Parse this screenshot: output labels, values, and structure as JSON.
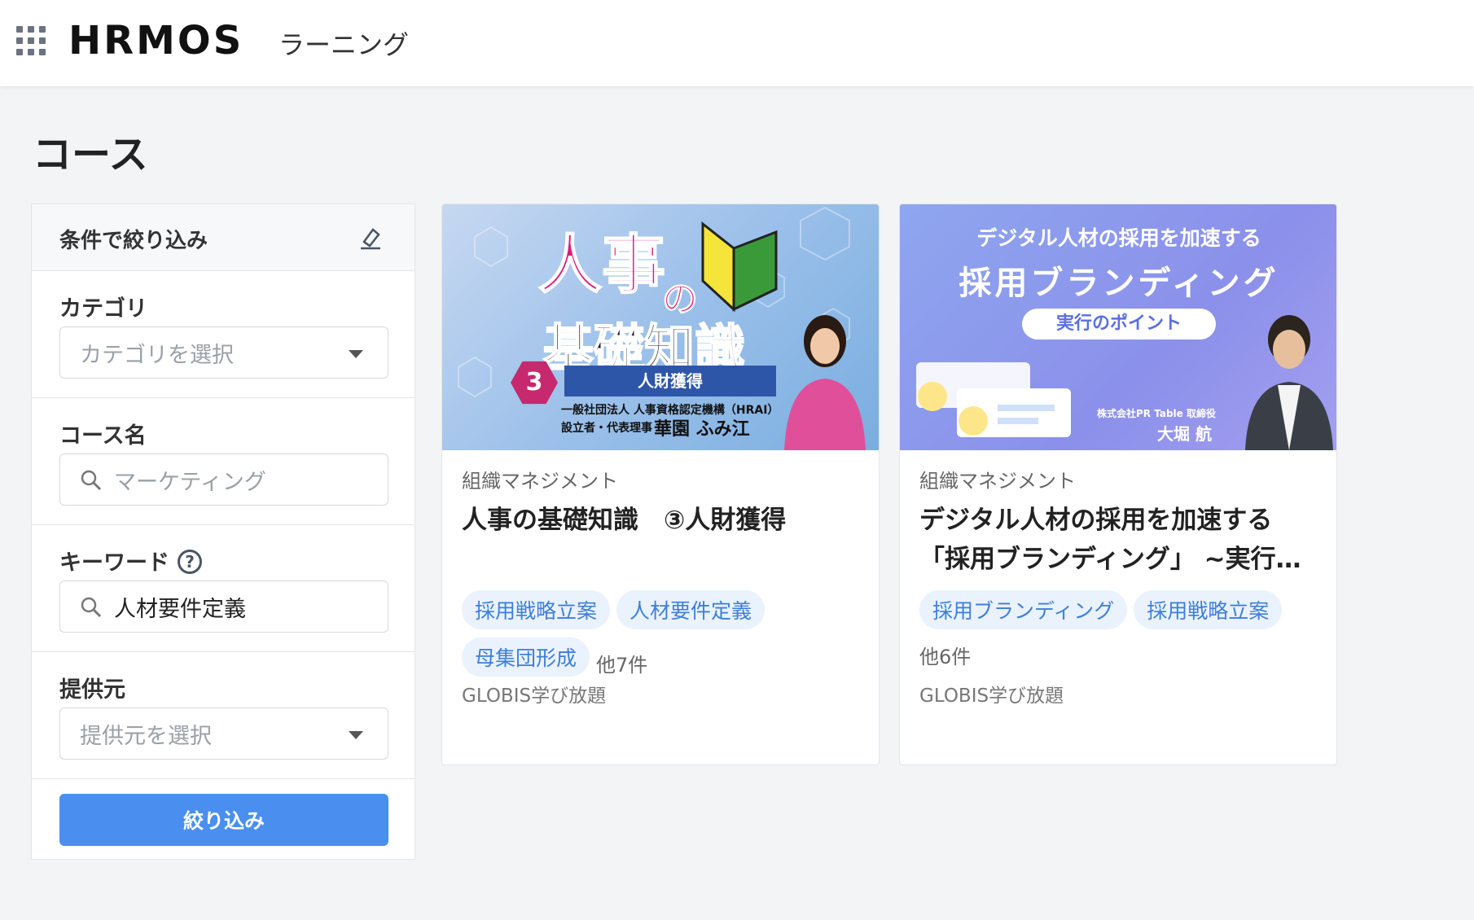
{
  "header": {
    "logo": "HRMOS",
    "product": "ラーニング"
  },
  "page": {
    "title": "コース"
  },
  "filter": {
    "title": "条件で絞り込み",
    "category": {
      "label": "カテゴリ",
      "placeholder": "カテゴリを選択"
    },
    "course_name": {
      "label": "コース名",
      "placeholder": "マーケティング"
    },
    "keyword": {
      "label": "キーワード",
      "value": "人材要件定義",
      "help": "?"
    },
    "provider": {
      "label": "提供元",
      "placeholder": "提供元を選択"
    },
    "submit_label": "絞り込み"
  },
  "courses": [
    {
      "category": "組織マネジメント",
      "title": "人事の基礎知識　③人財獲得",
      "tags": [
        "採用戦略立案",
        "人材要件定義",
        "母集団形成"
      ],
      "more": "他7件",
      "provider": "GLOBIS学び放題",
      "thumbnail": {
        "line1": "人事",
        "line1b": "の",
        "line2": "基礎知識",
        "number": "3",
        "band": "人財獲得",
        "org": "一般社団法人 人事資格認定機構（HRAI）",
        "role": "設立者・代表理事",
        "name": "華園 ふみ江"
      }
    },
    {
      "category": "組織マネジメント",
      "title": "デジタル人材の採用を加速する「採用ブランディング」 ~実行…",
      "tags": [
        "採用ブランディング",
        "採用戦略立案"
      ],
      "more": "他6件",
      "provider": "GLOBIS学び放題",
      "thumbnail": {
        "sub": "デジタル人材の採用を加速する",
        "main": "採用ブランディング",
        "pill": "実行のポイント",
        "company": "株式会社PR Table 取締役",
        "name": "大堀 航"
      }
    }
  ],
  "colors": {
    "accent": "#4a8ff0",
    "tag_bg": "#eaf2fd",
    "tag_text": "#3d7fd9"
  }
}
